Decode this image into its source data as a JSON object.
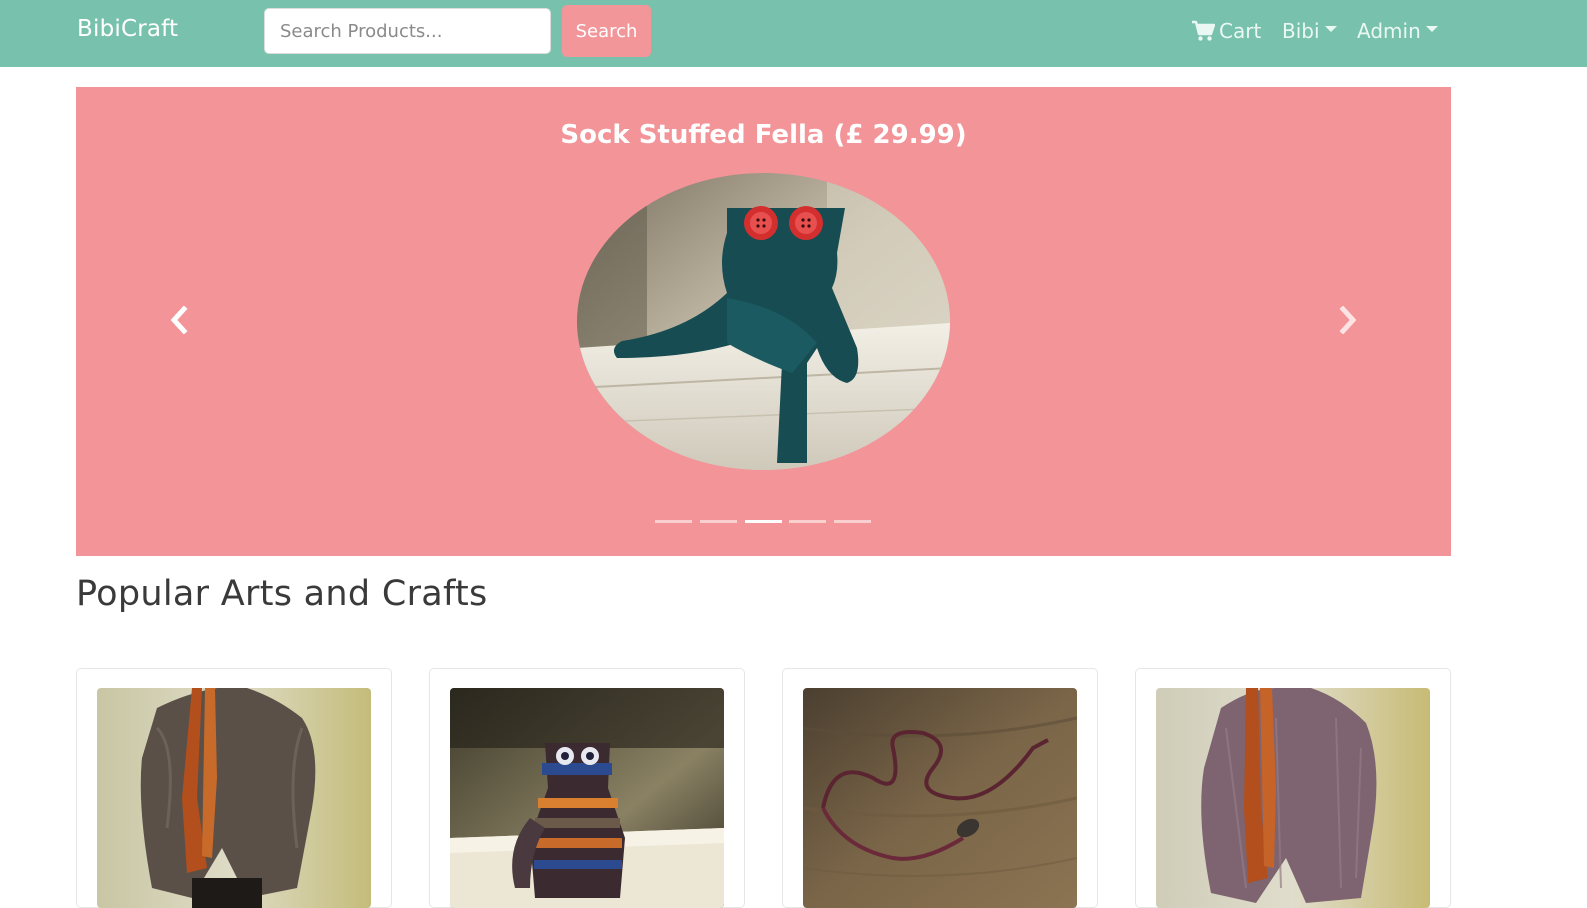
{
  "navbar": {
    "brand": "BibiCraft",
    "search_placeholder": "Search Products...",
    "search_button": "Search",
    "cart_label": "Cart",
    "user_menu": "Bibi",
    "admin_menu": "Admin",
    "background_color": "#78c2ad",
    "accent_color": "#f3969a"
  },
  "carousel": {
    "title": "Sock Stuffed Fella (£ 29.99)",
    "background_color": "#f29498",
    "indicator_count": 5,
    "active_index": 2
  },
  "popular": {
    "title": "Popular Arts and Crafts",
    "products": [
      {
        "image": "woman-in-grey-poncho-with-orange-scarf"
      },
      {
        "image": "striped-sock-creature-sitting-on-bench"
      },
      {
        "image": "braided-beaded-cord-necklace-on-wood"
      },
      {
        "image": "woman-in-patterned-poncho-with-rust-scarf"
      }
    ]
  }
}
